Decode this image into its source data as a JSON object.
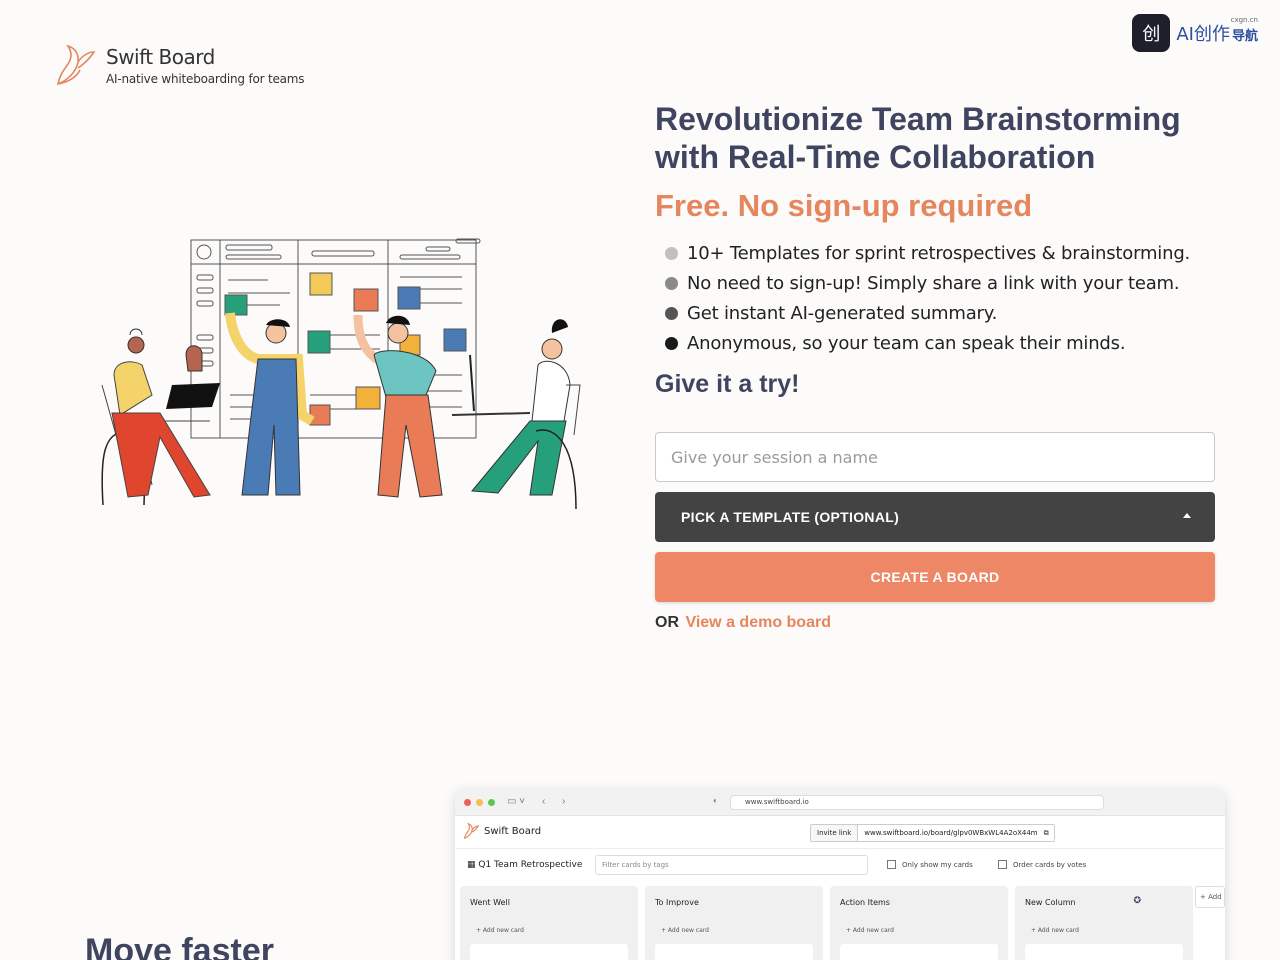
{
  "brand": {
    "name": "Swift Board",
    "tagline": "AI-native whiteboarding for teams",
    "accent": "#ee8765",
    "heading_color": "#3f4560"
  },
  "badge": {
    "icon": "创",
    "text": "AI创作",
    "sub": "导航",
    "sup": "cxgn.cn"
  },
  "hero": {
    "title": "Revolutionize Team Brainstorming with Real-Time Collaboration",
    "free": "Free. No sign-up required",
    "features": [
      {
        "text": "10+ Templates for sprint retrospectives & brainstorming.",
        "dot": "#c0c0c0"
      },
      {
        "text": "No need to sign-up! Simply share a link with your team.",
        "dot": "#8a8a8a"
      },
      {
        "text": "Get instant AI-generated summary.",
        "dot": "#545454"
      },
      {
        "text": "Anonymous, so your team can speak their minds.",
        "dot": "#1a1a1a"
      }
    ],
    "try": "Give it a try!"
  },
  "form": {
    "session_placeholder": "Give your session a name",
    "pick_template": "PICK A TEMPLATE (OPTIONAL)",
    "create": "CREATE A BOARD",
    "or": "OR",
    "demo_link": "View a demo board"
  },
  "section": {
    "heading": "Move faster"
  },
  "preview": {
    "url": "www.swiftboard.io",
    "app_name": "Swift Board",
    "invite_label": "Invite link",
    "invite_url": "www.swiftboard.io/board/glpv0WBxWL4A2oX44m",
    "board_title": "Q1 Team Retrospective",
    "filter_placeholder": "Filter cards by tags",
    "only_my_cards": "Only show my cards",
    "order_by_votes": "Order cards by votes",
    "add_new_card": "+ Add new card",
    "columns": [
      "Went Well",
      "To Improve",
      "Action Items",
      "New Column"
    ],
    "add_column": "+ Add"
  }
}
